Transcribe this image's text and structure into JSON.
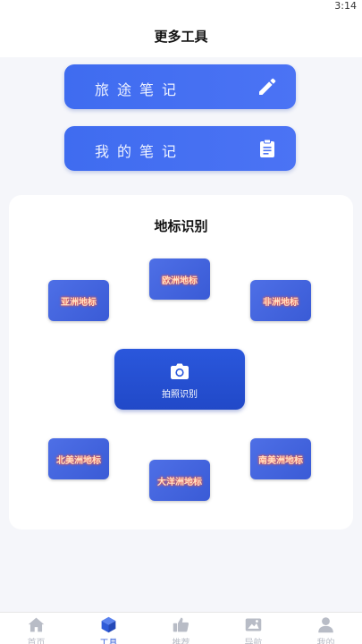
{
  "status": {
    "time": "3:14"
  },
  "header": {
    "title": "更多工具"
  },
  "notes": {
    "travel_label": "旅途笔记",
    "travel_icon": "pencil-icon",
    "mine_label": "我的笔记",
    "mine_icon": "clipboard-icon"
  },
  "landmarks": {
    "title": "地标识别",
    "europe": "欧洲地标",
    "asia": "亚洲地标",
    "africa": "非洲地标",
    "north_america": "北美洲地标",
    "south_america": "南美洲地标",
    "oceania": "大洋洲地标",
    "capture_label": "拍照识别",
    "capture_icon": "camera-icon"
  },
  "tabbar": {
    "items": [
      {
        "label": "首页",
        "icon": "home-icon",
        "active": false
      },
      {
        "label": "工具",
        "icon": "cube-icon",
        "active": true
      },
      {
        "label": "推荐",
        "icon": "thumbs-up-icon",
        "active": false
      },
      {
        "label": "导航",
        "icon": "map-icon",
        "active": false
      },
      {
        "label": "我的",
        "icon": "user-icon",
        "active": false
      }
    ]
  },
  "colors": {
    "accent": "#2f5bd8",
    "button_blue": "#4b73f4",
    "inactive_tab": "#b8bcc6",
    "landmark_text_glow": "#ff5a3c"
  }
}
